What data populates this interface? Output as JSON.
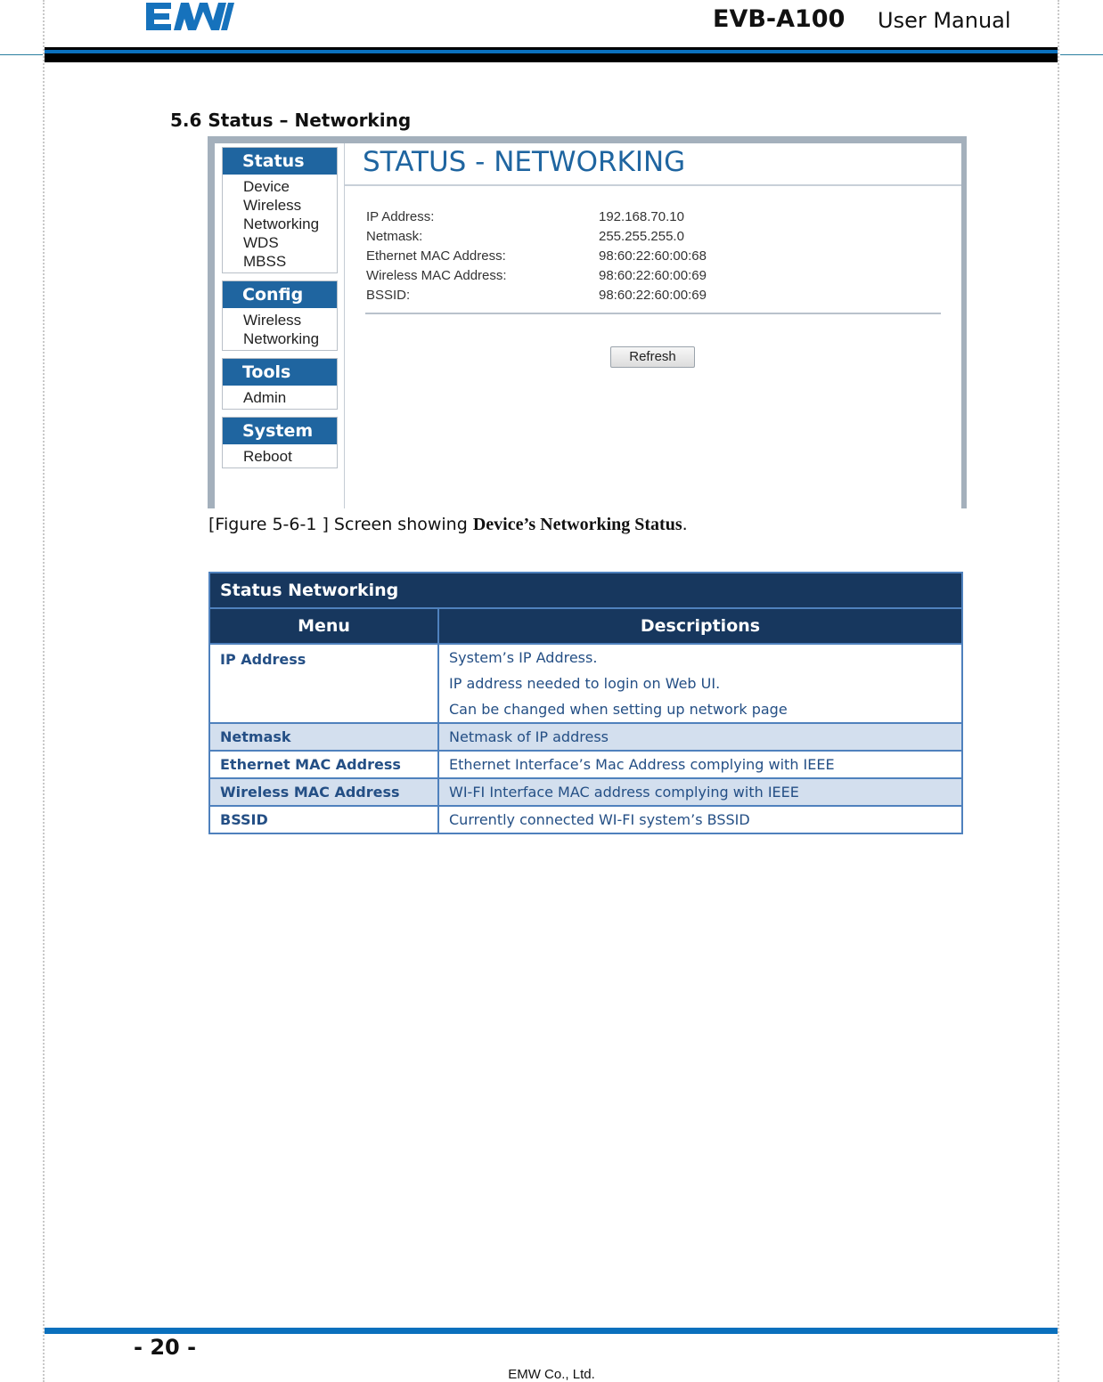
{
  "header": {
    "logo_text": "EMW",
    "product": "EVB-A100",
    "doc_type": "User  Manual"
  },
  "section": {
    "title": "5.6 Status – Networking"
  },
  "screenshot": {
    "sidebar": [
      {
        "heading": "Status",
        "items": [
          "Device",
          "Wireless",
          "Networking",
          "WDS",
          "MBSS"
        ]
      },
      {
        "heading": "Config",
        "items": [
          "Wireless",
          "Networking"
        ]
      },
      {
        "heading": "Tools",
        "items": [
          "Admin"
        ]
      },
      {
        "heading": "System",
        "items": [
          "Reboot"
        ]
      }
    ],
    "page_title": "STATUS - NETWORKING",
    "fields": [
      {
        "label": "IP Address:",
        "value": "192.168.70.10"
      },
      {
        "label": "Netmask:",
        "value": "255.255.255.0"
      },
      {
        "label": "Ethernet MAC Address:",
        "value": "98:60:22:60:00:68"
      },
      {
        "label": "Wireless MAC Address:",
        "value": "98:60:22:60:00:69"
      },
      {
        "label": "BSSID:",
        "value": "98:60:22:60:00:69"
      }
    ],
    "refresh_label": "Refresh",
    "colors": {
      "accent": "#1f65a0",
      "frame": "#a4b0bc"
    }
  },
  "caption": {
    "prefix": "[Figure 5-6-1 ] Screen showing ",
    "bold": "Device’s Networking Status",
    "suffix": "."
  },
  "table": {
    "title": "Status Networking",
    "columns": [
      "Menu",
      "Descriptions"
    ],
    "rows": [
      {
        "menu": "IP Address",
        "desc": [
          "System’s IP Address.",
          "IP address needed to login on Web UI.",
          "Can be changed when setting up network page"
        ]
      },
      {
        "menu": "Netmask",
        "desc": [
          "Netmask of IP address"
        ]
      },
      {
        "menu": "Ethernet MAC Address",
        "desc": [
          "Ethernet Interface’s Mac Address complying with IEEE"
        ]
      },
      {
        "menu": "Wireless MAC Address",
        "desc": [
          "WI-FI Interface MAC address complying with IEEE"
        ]
      },
      {
        "menu": "BSSID",
        "desc": [
          "Currently connected WI-FI system’s BSSID"
        ]
      }
    ],
    "colors": {
      "header_bg": "#17375e",
      "alt_row_bg": "#d3dfee",
      "text": "#244f85",
      "border": "#4f81bd"
    }
  },
  "footer": {
    "page_number": "- 20 -",
    "company": "EMW Co., Ltd."
  }
}
